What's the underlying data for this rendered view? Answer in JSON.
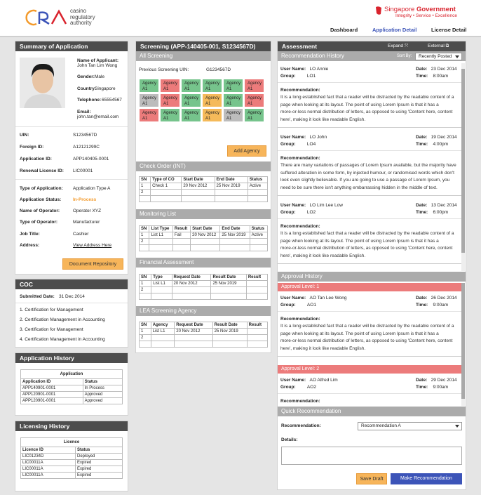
{
  "brand": {
    "logo_text_1": "casino",
    "logo_text_2": "regulatory",
    "logo_text_3": "authority"
  },
  "gov": {
    "title_1": "Singapore",
    "title_2": "Government",
    "sub": "Integrity • Service • Excellence"
  },
  "nav": {
    "dashboard": "Dashboard",
    "detail": "Application Detail",
    "license": "License Detail"
  },
  "summary": {
    "title": "Summary of Application",
    "name_label": "Name of Applicant:",
    "name": "John Tan Lim Wong",
    "gender_label": "Gender:",
    "gender": "Male",
    "country_label": "Country:",
    "country": "Singapore",
    "tel_label": "Telephone:",
    "tel": "65554567",
    "email_label": "Email:",
    "email": "john.tan@email.com",
    "uin_label": "UIN:",
    "uin": "S1234567D",
    "foreign_label": "Foreign ID:",
    "foreign": "A12121299C",
    "appid_label": "Application ID:",
    "appid": "APP140405-0001",
    "renewal_label": "Renewal License ID:",
    "renewal": "LIC00001",
    "type_label": "Type of Application:",
    "type": "Application Type A",
    "status_label": "Application Status:",
    "status": "In-Process",
    "operator_label": "Name of Operator:",
    "operator": "Operator XYZ",
    "optype_label": "Type of Operator:",
    "optype": "Manufacturer",
    "job_label": "Job Title:",
    "job": "Cashier",
    "address_label": "Address:",
    "address": "View Address Here",
    "doc_button": "Document Repository"
  },
  "coc": {
    "title": "COC",
    "submitted_label": "Submitted Date:",
    "submitted": "31 Dec 2014",
    "items": [
      "1. Certification for Management",
      "2. Certification Management in Accounting",
      "3. Certification for Management",
      "4. Certification Management in Accounting"
    ]
  },
  "app_history": {
    "title": "Application History",
    "table_title": "Application",
    "headers": [
      "Application ID",
      "Status"
    ],
    "rows": [
      [
        "APP140901-0001",
        "In Process"
      ],
      [
        "APP120901-0001",
        "Approved"
      ],
      [
        "APP120901-0001",
        "Approved"
      ]
    ]
  },
  "lic_history": {
    "title": "Licensing History",
    "table_title": "Licence",
    "headers": [
      "Licence ID",
      "Status"
    ],
    "rows": [
      [
        "LIC01234D",
        "Deployed"
      ],
      [
        "LIC00011A",
        "Expired"
      ],
      [
        "LIC00011A",
        "Expired"
      ],
      [
        "LIC00011A",
        "Expired"
      ]
    ]
  },
  "screening": {
    "title": "Screening (APP-140405-001, S1234567D)",
    "all_title": "All Screening",
    "prev_label": "Previous Screening UIN:",
    "prev": "G1234567D",
    "agency_text": "Agency A1",
    "agency_colors": [
      "g",
      "r",
      "g",
      "g",
      "g",
      "r",
      "gr",
      "r",
      "g",
      "o",
      "g",
      "r",
      "r",
      "g",
      "g",
      "o",
      "gr",
      "g"
    ],
    "add_button": "Add Agency",
    "check_order": {
      "title": "Check Order (INT)",
      "headers": [
        "SN",
        "Type of CO",
        "Start Date",
        "End Date",
        "Status"
      ],
      "rows": [
        [
          "1",
          "Check 1",
          "20 Nov 2012",
          "25 Nov 2019",
          "Active"
        ],
        [
          "2",
          "",
          "",
          "",
          ""
        ]
      ]
    },
    "monitoring": {
      "title": "Monitoring List",
      "headers": [
        "SN",
        "List Type",
        "Result",
        "Start Date",
        "End Date",
        "Status"
      ],
      "rows": [
        [
          "1",
          "List L1",
          "Fail",
          "20 Nov 2012",
          "25 Nov 2019",
          "Active"
        ],
        [
          "2",
          "",
          "",
          "",
          "",
          ""
        ]
      ]
    },
    "financial": {
      "title": "Financial Assessment",
      "headers": [
        "SN",
        "Type",
        "Request Date",
        "Result Date",
        "Result"
      ],
      "rows": [
        [
          "1",
          "List L1",
          "20 Nov 2012",
          "25 Nov 2019",
          ""
        ],
        [
          "2",
          "",
          "",
          "",
          ""
        ]
      ]
    },
    "lea": {
      "title": "LEA Screening Agency",
      "headers": [
        "SN",
        "Agency",
        "Request Date",
        "Result Date",
        "Result"
      ],
      "rows": [
        [
          "1",
          "List L1",
          "20 Nov 2012",
          "25 Nov 2019",
          ""
        ],
        [
          "2",
          "",
          "",
          "",
          ""
        ]
      ]
    }
  },
  "assessment": {
    "title": "Assessment",
    "expand": "Expand",
    "external": "External",
    "rec_history": "Recommendation History",
    "sort_label": "Sort By:",
    "sort_value": "Recently Posted",
    "user_label": "User Name:",
    "group_label": "Group:",
    "date_label": "Date:",
    "time_label": "Time:",
    "rec_label": "Recommendation:",
    "recs": [
      {
        "user": "LO Annie",
        "group": "LO1",
        "date": "23 Dec 2014",
        "time": "8:00am",
        "text": [
          "It is a long established fact that a reader will be distracted by the readable content of a",
          "page when looking at its layout. The point of using Lorem Ipsum is that it has a",
          "more-or-less normal distribution of letters, as opposed to using 'Content here, content",
          "here', making it look like readable English."
        ]
      },
      {
        "user": "LO John",
        "group": "LO4",
        "date": "19 Dec 2014",
        "time": "4:00pm",
        "text": [
          "There are many variations of passages of Lorem Ipsum available, but the majority have",
          "suffered alteration in some form, by injected humour, or randomised words which don't",
          "look even slightly believable. If you are going to use a passage of Lorem Ipsum, you",
          "need to be sure there isn't anything embarrassing hidden in the middle of text."
        ]
      },
      {
        "user": "LO Lim Lee Low",
        "group": "LO2",
        "date": "13 Dec 2014",
        "time": "6:00pm",
        "text": [
          "It is a long established fact that a reader will be distracted by the readable content of a",
          "page when looking at its layout. The point of using Lorem Ipsum is that it has a",
          "more-or-less normal distribution of letters, as opposed to using 'Content here, content",
          "here', making it look like readable English."
        ]
      }
    ],
    "approval_history": "Approval History",
    "approvals": [
      {
        "level": "Approval Level: 1",
        "user": "AO Tan Lee Wong",
        "group": "AO1",
        "date": "26 Dec 2014",
        "time": "9:00am",
        "text": [
          "It is a long established fact that a reader will be distracted by the readable content of a",
          "page when looking at its layout. The point of using Lorem Ipsum is that it has a",
          "more-or-less normal distribution of letters, as opposed to using 'Content here, content",
          "here', making it look like readable English."
        ]
      },
      {
        "level": "Approval Level: 2",
        "user": "AO Alfred Lim",
        "group": "AO2",
        "date": "29 Dec 2014",
        "time": "9:00am",
        "text": []
      }
    ],
    "quick": "Quick Recommendation",
    "quick_rec_label": "Recommendation:",
    "quick_rec_value": "Recommendation A",
    "details_label": "Details:",
    "save_draft": "Save Draft",
    "make_rec": "Make Recommendation"
  }
}
